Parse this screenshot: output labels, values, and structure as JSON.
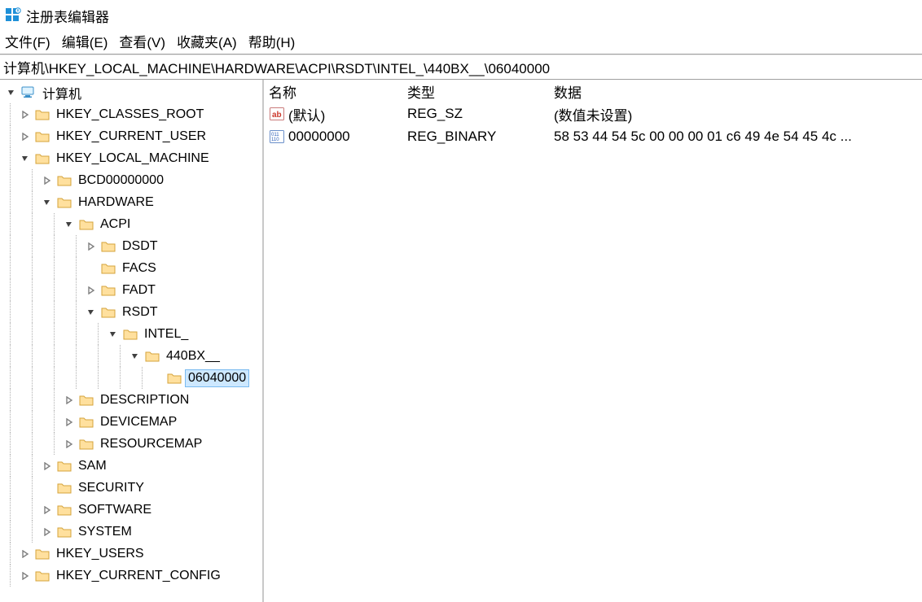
{
  "window": {
    "title": "注册表编辑器"
  },
  "menu": {
    "file": "文件(F)",
    "edit": "编辑(E)",
    "view": "查看(V)",
    "favorites": "收藏夹(A)",
    "help": "帮助(H)"
  },
  "address": "计算机\\HKEY_LOCAL_MACHINE\\HARDWARE\\ACPI\\RSDT\\INTEL_\\440BX__\\06040000",
  "tree": {
    "root": "计算机",
    "hkcr": "HKEY_CLASSES_ROOT",
    "hkcu": "HKEY_CURRENT_USER",
    "hklm": "HKEY_LOCAL_MACHINE",
    "hklm_children": {
      "bcd": "BCD00000000",
      "hardware": "HARDWARE",
      "hardware_children": {
        "acpi": "ACPI",
        "acpi_children": {
          "dsdt": "DSDT",
          "facs": "FACS",
          "fadt": "FADT",
          "rsdt": "RSDT",
          "rsdt_children": {
            "intel": "INTEL_",
            "intel_children": {
              "bx": "440BX__",
              "bx_children": {
                "sel": "06040000"
              }
            }
          }
        },
        "description": "DESCRIPTION",
        "devicemap": "DEVICEMAP",
        "resourcemap": "RESOURCEMAP"
      },
      "sam": "SAM",
      "security": "SECURITY",
      "software": "SOFTWARE",
      "system": "SYSTEM"
    },
    "hku": "HKEY_USERS",
    "hkcc": "HKEY_CURRENT_CONFIG"
  },
  "list": {
    "headers": {
      "name": "名称",
      "type": "类型",
      "data": "数据"
    },
    "rows": [
      {
        "name": "(默认)",
        "type": "REG_SZ",
        "data": "(数值未设置)",
        "kind": "string"
      },
      {
        "name": "00000000",
        "type": "REG_BINARY",
        "data": "58 53 44 54 5c 00 00 00 01 c6 49 4e 54 45 4c ...",
        "kind": "binary"
      }
    ]
  }
}
